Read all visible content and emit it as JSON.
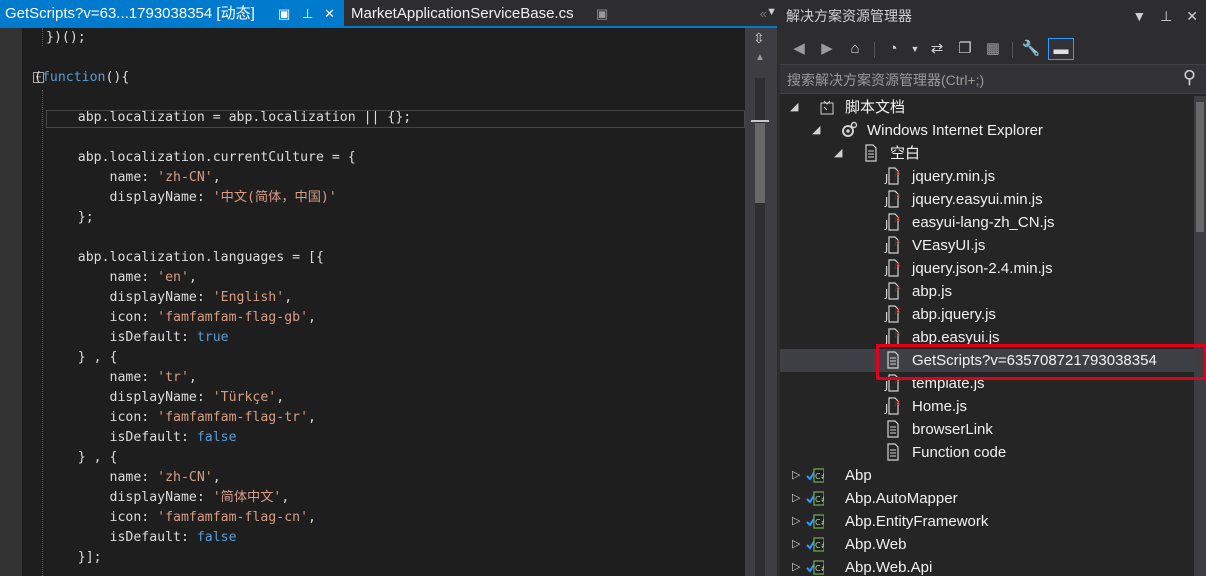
{
  "editor": {
    "tabs": [
      {
        "label": "GetScripts?v=63...1793038354 [动态]",
        "active": true
      },
      {
        "label": "MarketApplicationServiceBase.cs",
        "active": false
      }
    ],
    "code_lines": [
      "})();",
      "",
      "(function(){",
      "",
      "    abp.localization = abp.localization || {};",
      "",
      "    abp.localization.currentCulture = {",
      "        name: 'zh-CN',",
      "        displayName: '中文(简体，中国)'",
      "    };",
      "",
      "    abp.localization.languages = [{",
      "        name: 'en',",
      "        displayName: 'English',",
      "        icon: 'famfamfam-flag-gb',",
      "        isDefault: true",
      "    } , {",
      "        name: 'tr',",
      "        displayName: 'Türkçe',",
      "        icon: 'famfamfam-flag-tr',",
      "        isDefault: false",
      "    } , {",
      "        name: 'zh-CN',",
      "        displayName: '简体中文',",
      "        icon: 'famfamfam-flag-cn',",
      "        isDefault: false",
      "    }];"
    ]
  },
  "solution_explorer": {
    "title": "解决方案资源管理器",
    "search_placeholder": "搜索解决方案资源管理器(Ctrl+;)",
    "tree": [
      {
        "label": "脚本文档",
        "icon": "script-documents-icon",
        "expanded": true
      },
      {
        "label": "Windows Internet Explorer",
        "icon": "ie-gear-icon",
        "expanded": true
      },
      {
        "label": "空白",
        "icon": "page-icon",
        "expanded": true
      },
      {
        "label": "jquery.min.js",
        "icon": "js-file-icon"
      },
      {
        "label": "jquery.easyui.min.js",
        "icon": "js-file-icon"
      },
      {
        "label": "easyui-lang-zh_CN.js",
        "icon": "js-file-icon"
      },
      {
        "label": "VEasyUI.js",
        "icon": "js-file-icon"
      },
      {
        "label": "jquery.json-2.4.min.js",
        "icon": "js-file-icon"
      },
      {
        "label": "abp.js",
        "icon": "js-file-icon"
      },
      {
        "label": "abp.jquery.js",
        "icon": "js-file-icon"
      },
      {
        "label": "abp.easyui.js",
        "icon": "js-file-icon"
      },
      {
        "label": "GetScripts?v=635708721793038354",
        "icon": "page-icon",
        "selected": true
      },
      {
        "label": "template.js",
        "icon": "js-file-icon"
      },
      {
        "label": "Home.js",
        "icon": "js-file-icon"
      },
      {
        "label": "browserLink",
        "icon": "page-icon"
      },
      {
        "label": "Function code",
        "icon": "page-icon"
      },
      {
        "label": "Abp",
        "icon": "csharp-project-icon"
      },
      {
        "label": "Abp.AutoMapper",
        "icon": "csharp-project-icon"
      },
      {
        "label": "Abp.EntityFramework",
        "icon": "csharp-project-icon"
      },
      {
        "label": "Abp.Web",
        "icon": "csharp-project-icon"
      },
      {
        "label": "Abp.Web.Api",
        "icon": "csharp-project-icon"
      }
    ]
  },
  "colors": {
    "accent": "#007acc",
    "highlight": "#e0001a"
  }
}
